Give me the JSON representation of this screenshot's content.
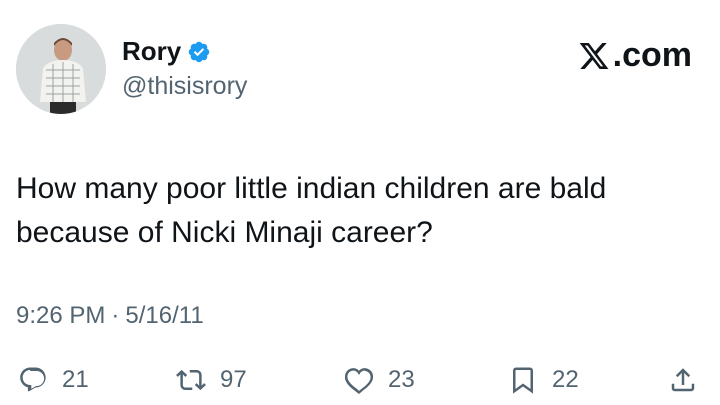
{
  "author": {
    "name": "Rory",
    "handle": "@thisisrory",
    "verified": true
  },
  "brand": {
    "text": ".com"
  },
  "tweet": {
    "text": "How many poor little indian children are bald because of Nicki Minaji career?",
    "time": "9:26 PM",
    "separator": "·",
    "date": "5/16/11"
  },
  "actions": {
    "replies": "21",
    "retweets": "97",
    "likes": "23",
    "bookmarks": "22"
  },
  "colors": {
    "text": "#0f1419",
    "secondary": "#536471",
    "verified": "#1d9bf0"
  }
}
